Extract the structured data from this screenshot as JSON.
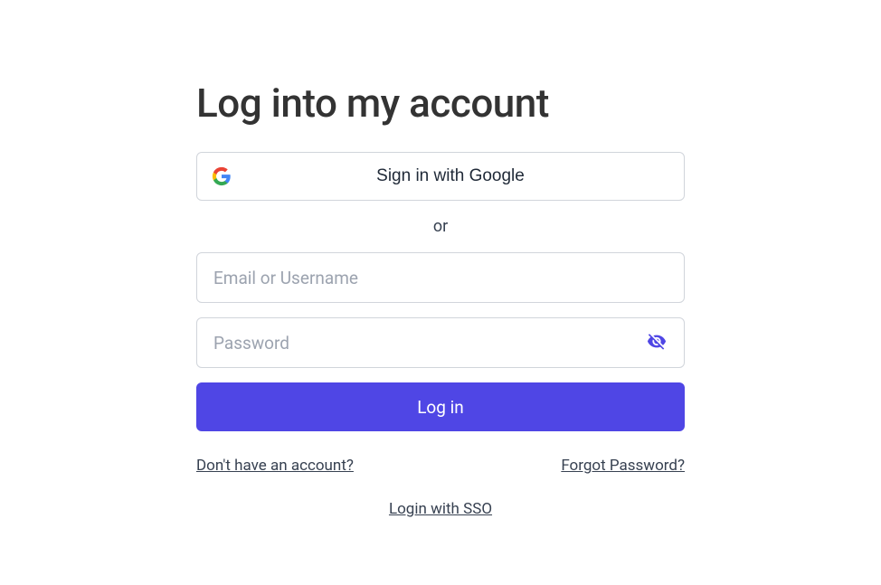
{
  "title": "Log into my account",
  "google": {
    "label": "Sign in with Google"
  },
  "divider": "or",
  "fields": {
    "email_placeholder": "Email or Username",
    "password_placeholder": "Password"
  },
  "buttons": {
    "login": "Log in"
  },
  "links": {
    "signup": "Don't have an account?",
    "forgot": "Forgot Password?",
    "sso": "Login with SSO"
  },
  "colors": {
    "primary": "#4f46e5",
    "border": "#d1d5db",
    "text": "#374151",
    "placeholder": "#9ca3af"
  }
}
